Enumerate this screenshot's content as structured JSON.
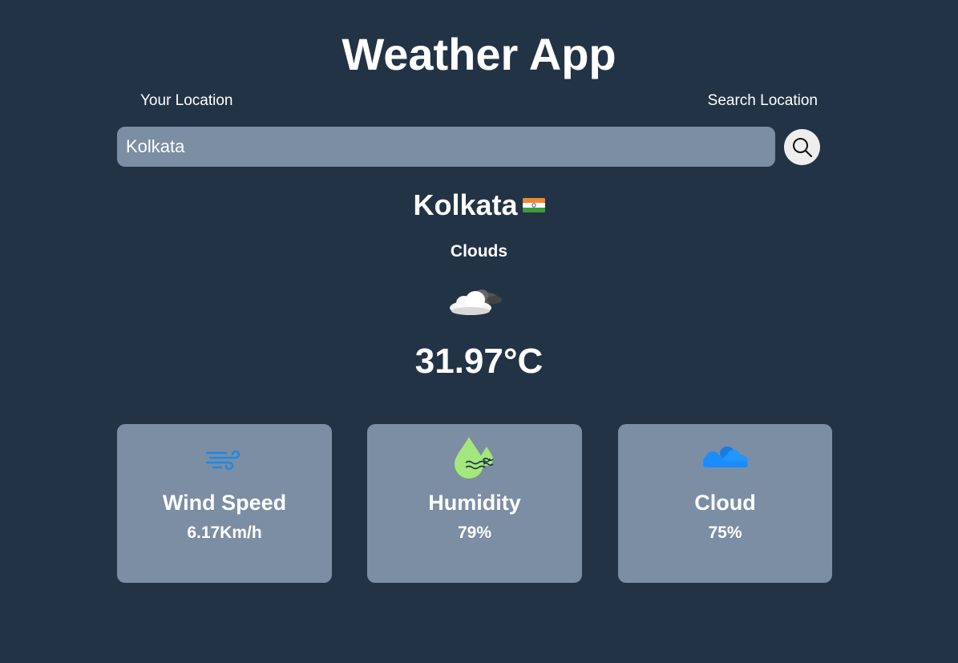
{
  "app": {
    "title": "Weather App"
  },
  "tabs": {
    "your_location": "Your Location",
    "search_location": "Search Location"
  },
  "search": {
    "value": "Kolkata",
    "placeholder": "",
    "button_icon": "search-icon"
  },
  "weather": {
    "city": "Kolkata",
    "country_flag_icon": "india-flag-icon",
    "condition": "Clouds",
    "condition_icon": "clouds-icon",
    "temperature": "31.97°C"
  },
  "cards": [
    {
      "label": "Wind Speed",
      "value": "6.17Km/h",
      "icon": "wind-icon"
    },
    {
      "label": "Humidity",
      "value": "79%",
      "icon": "humidity-icon"
    },
    {
      "label": "Cloud",
      "value": "75%",
      "icon": "cloud-icon"
    }
  ],
  "colors": {
    "background": "#223345",
    "panel": "#7b8ea3",
    "text": "#ffffff",
    "wind_icon": "#1e88e5",
    "humidity_icon": "#a4e77c",
    "cloud_icon": "#1a8cff"
  }
}
